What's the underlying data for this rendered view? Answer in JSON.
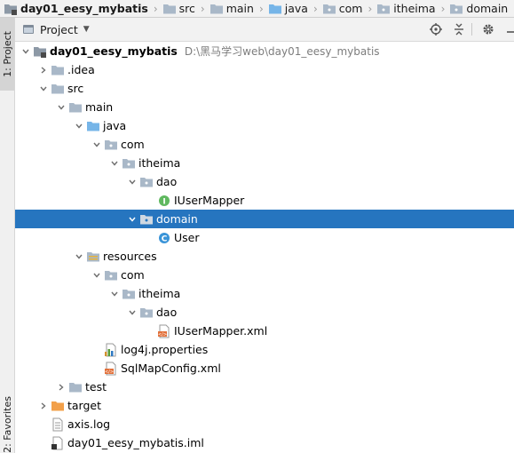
{
  "breadcrumb": [
    {
      "label": "day01_eesy_mybatis",
      "icon": "module-folder-icon"
    },
    {
      "label": "src",
      "icon": "folder-icon"
    },
    {
      "label": "main",
      "icon": "folder-icon"
    },
    {
      "label": "java",
      "icon": "source-folder-icon"
    },
    {
      "label": "com",
      "icon": "package-icon"
    },
    {
      "label": "itheima",
      "icon": "package-icon"
    },
    {
      "label": "domain",
      "icon": "package-icon"
    }
  ],
  "sidebar": {
    "project_tab": "1: Project",
    "favorites_tab": "2: Favorites"
  },
  "toolwindow": {
    "title": "Project",
    "buttons": [
      "locate-icon",
      "collapse-all-icon",
      "gear-icon",
      "hide-icon"
    ]
  },
  "tree": [
    {
      "label": "day01_eesy_mybatis",
      "path": "D:\\黑马学习web\\day01_eesy_mybatis",
      "icon": "module-folder-icon",
      "arrow": "down",
      "bold": true
    },
    {
      "label": ".idea",
      "icon": "folder-icon",
      "arrow": "right"
    },
    {
      "label": "src",
      "icon": "folder-icon",
      "arrow": "down"
    },
    {
      "label": "main",
      "icon": "folder-icon",
      "arrow": "down"
    },
    {
      "label": "java",
      "icon": "source-folder-icon",
      "arrow": "down"
    },
    {
      "label": "com",
      "icon": "package-icon",
      "arrow": "down"
    },
    {
      "label": "itheima",
      "icon": "package-icon",
      "arrow": "down"
    },
    {
      "label": "dao",
      "icon": "package-icon",
      "arrow": "down"
    },
    {
      "label": "IUserMapper",
      "icon": "interface-icon",
      "arrow": "none"
    },
    {
      "label": "domain",
      "icon": "package-icon",
      "arrow": "down",
      "selected": true
    },
    {
      "label": "User",
      "icon": "class-icon",
      "arrow": "none"
    },
    {
      "label": "resources",
      "icon": "resources-folder-icon",
      "arrow": "down"
    },
    {
      "label": "com",
      "icon": "package-icon",
      "arrow": "down"
    },
    {
      "label": "itheima",
      "icon": "package-icon",
      "arrow": "down"
    },
    {
      "label": "dao",
      "icon": "package-icon",
      "arrow": "down"
    },
    {
      "label": "IUserMapper.xml",
      "icon": "xml-file-icon",
      "arrow": "none"
    },
    {
      "label": "log4j.properties",
      "icon": "properties-file-icon",
      "arrow": "none"
    },
    {
      "label": "SqlMapConfig.xml",
      "icon": "xml-file-icon",
      "arrow": "none"
    },
    {
      "label": "test",
      "icon": "folder-icon",
      "arrow": "right"
    },
    {
      "label": "target",
      "icon": "excluded-folder-icon",
      "arrow": "right"
    },
    {
      "label": "axis.log",
      "icon": "text-file-icon",
      "arrow": "none"
    },
    {
      "label": "day01_eesy_mybatis.iml",
      "icon": "iml-file-icon",
      "arrow": "none"
    }
  ],
  "colors": {
    "selection": "#2675bf",
    "folder": "#a9b8c8",
    "source_folder": "#76b5e8",
    "excluded_folder": "#f2a04a",
    "interface": "#5fb85f",
    "class": "#3a94d8"
  }
}
